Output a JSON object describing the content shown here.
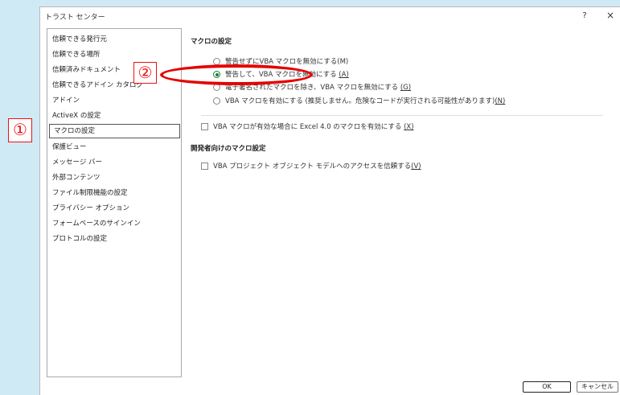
{
  "window": {
    "title": "トラスト センター",
    "help_label": "?",
    "close_label": "×"
  },
  "sidebar": {
    "items": [
      {
        "label": "信頼できる発行元",
        "selected": false
      },
      {
        "label": "信頼できる場所",
        "selected": false
      },
      {
        "label": "信頼済みドキュメント",
        "selected": false
      },
      {
        "label": "信頼できるアドイン カタログ",
        "selected": false
      },
      {
        "label": "アドイン",
        "selected": false
      },
      {
        "label": "ActiveX の設定",
        "selected": false
      },
      {
        "label": "マクロの設定",
        "selected": true
      },
      {
        "label": "保護ビュー",
        "selected": false
      },
      {
        "label": "メッセージ バー",
        "selected": false
      },
      {
        "label": "外部コンテンツ",
        "selected": false
      },
      {
        "label": "ファイル制限機能の設定",
        "selected": false
      },
      {
        "label": "プライバシー オプション",
        "selected": false
      },
      {
        "label": "フォームベースのサインイン",
        "selected": false
      },
      {
        "label": "プロトコルの設定",
        "selected": false
      }
    ]
  },
  "macro_settings": {
    "title": "マクロの設定",
    "options": [
      {
        "label": "警告せずにVBA マクロを無効にする",
        "accel": "(M)",
        "checked": false
      },
      {
        "label": "警告して、VBA マクロを無効にする",
        "accel": "(A)",
        "checked": true
      },
      {
        "label": "電子署名されたマクロを除き、VBA マクロを無効にする",
        "accel": "(G)",
        "checked": false
      },
      {
        "label": "VBA マクロを有効にする (推奨しません。危険なコードが実行される可能性があります)",
        "accel": "(N)",
        "checked": false
      }
    ],
    "excel4_check": {
      "label": "VBA マクロが有効な場合に Excel 4.0 のマクロを有効にする",
      "accel": "(X)",
      "checked": false
    }
  },
  "developer_settings": {
    "title": "開発者向けのマクロ設定",
    "vba_access_check": {
      "label": "VBA プロジェクト オブジェクト モデルへのアクセスを信頼する",
      "accel": "(V)",
      "checked": false
    }
  },
  "footer": {
    "ok_label": "OK",
    "cancel_label": "キャンセル"
  },
  "annotations": {
    "marker1": "①",
    "marker2": "②",
    "color": "#e60000"
  },
  "colors": {
    "background": "#cfeaf5",
    "radio_checked": "#1a7f37"
  }
}
